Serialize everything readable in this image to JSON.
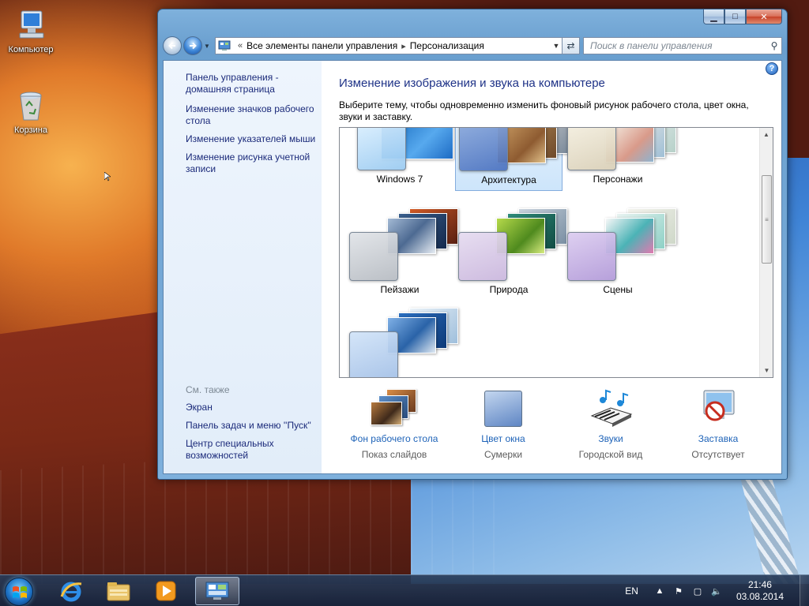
{
  "desktop": {
    "icons": [
      {
        "label": "Компьютер"
      },
      {
        "label": "Корзина"
      }
    ]
  },
  "window": {
    "address": {
      "path": [
        "Все элементы панели управления",
        "Персонализация"
      ]
    },
    "search": {
      "placeholder": "Поиск в панели управления"
    },
    "left_pane": {
      "links": [
        "Панель управления - домашняя страница",
        "Изменение значков рабочего стола",
        "Изменение указателей мыши",
        "Изменение рисунка учетной записи"
      ],
      "see_also": {
        "header": "См. также",
        "links": [
          "Экран",
          "Панель задач и меню ''Пуск''",
          "Центр специальных возможностей"
        ]
      }
    },
    "main": {
      "title": "Изменение изображения и звука на компьютере",
      "description": "Выберите тему, чтобы одновременно изменить фоновый рисунок рабочего стола, цвет окна, звуки и заставку.",
      "themes": [
        {
          "name": "Windows 7",
          "selected": false
        },
        {
          "name": "Архитектура",
          "selected": true
        },
        {
          "name": "Персонажи",
          "selected": false
        },
        {
          "name": "Пейзажи",
          "selected": false
        },
        {
          "name": "Природа",
          "selected": false
        },
        {
          "name": "Сцены",
          "selected": false
        }
      ],
      "bottom": [
        {
          "label": "Фон рабочего стола",
          "value": "Показ слайдов",
          "icon": "desktop-background-icon"
        },
        {
          "label": "Цвет окна",
          "value": "Сумерки",
          "icon": "window-color-icon"
        },
        {
          "label": "Звуки",
          "value": "Городской вид",
          "icon": "sounds-icon"
        },
        {
          "label": "Заставка",
          "value": "Отсутствует",
          "icon": "screensaver-icon"
        }
      ]
    }
  },
  "taskbar": {
    "language": "EN",
    "time": "21:46",
    "date": "03.08.2014"
  },
  "colors": {
    "link": "#1b2a7a",
    "heading": "#1e3287",
    "bottom_link": "#1e63b8"
  }
}
